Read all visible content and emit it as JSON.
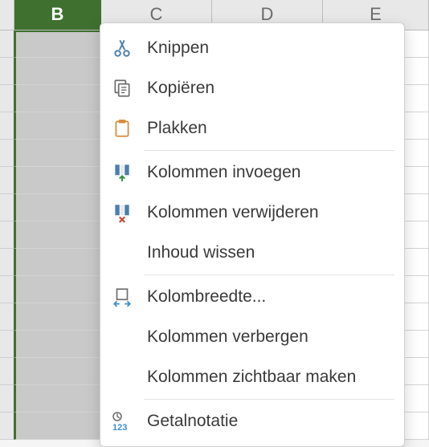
{
  "columns": {
    "b": "B",
    "c": "C",
    "d": "D",
    "e": "E"
  },
  "contextMenu": {
    "cut": "Knippen",
    "copy": "Kopiëren",
    "paste": "Plakken",
    "insertColumns": "Kolommen invoegen",
    "deleteColumns": "Kolommen verwijderen",
    "clearContents": "Inhoud wissen",
    "columnWidth": "Kolombreedte...",
    "hideColumns": "Kolommen verbergen",
    "unhideColumns": "Kolommen zichtbaar maken",
    "numberFormat": "Getalnotatie"
  }
}
